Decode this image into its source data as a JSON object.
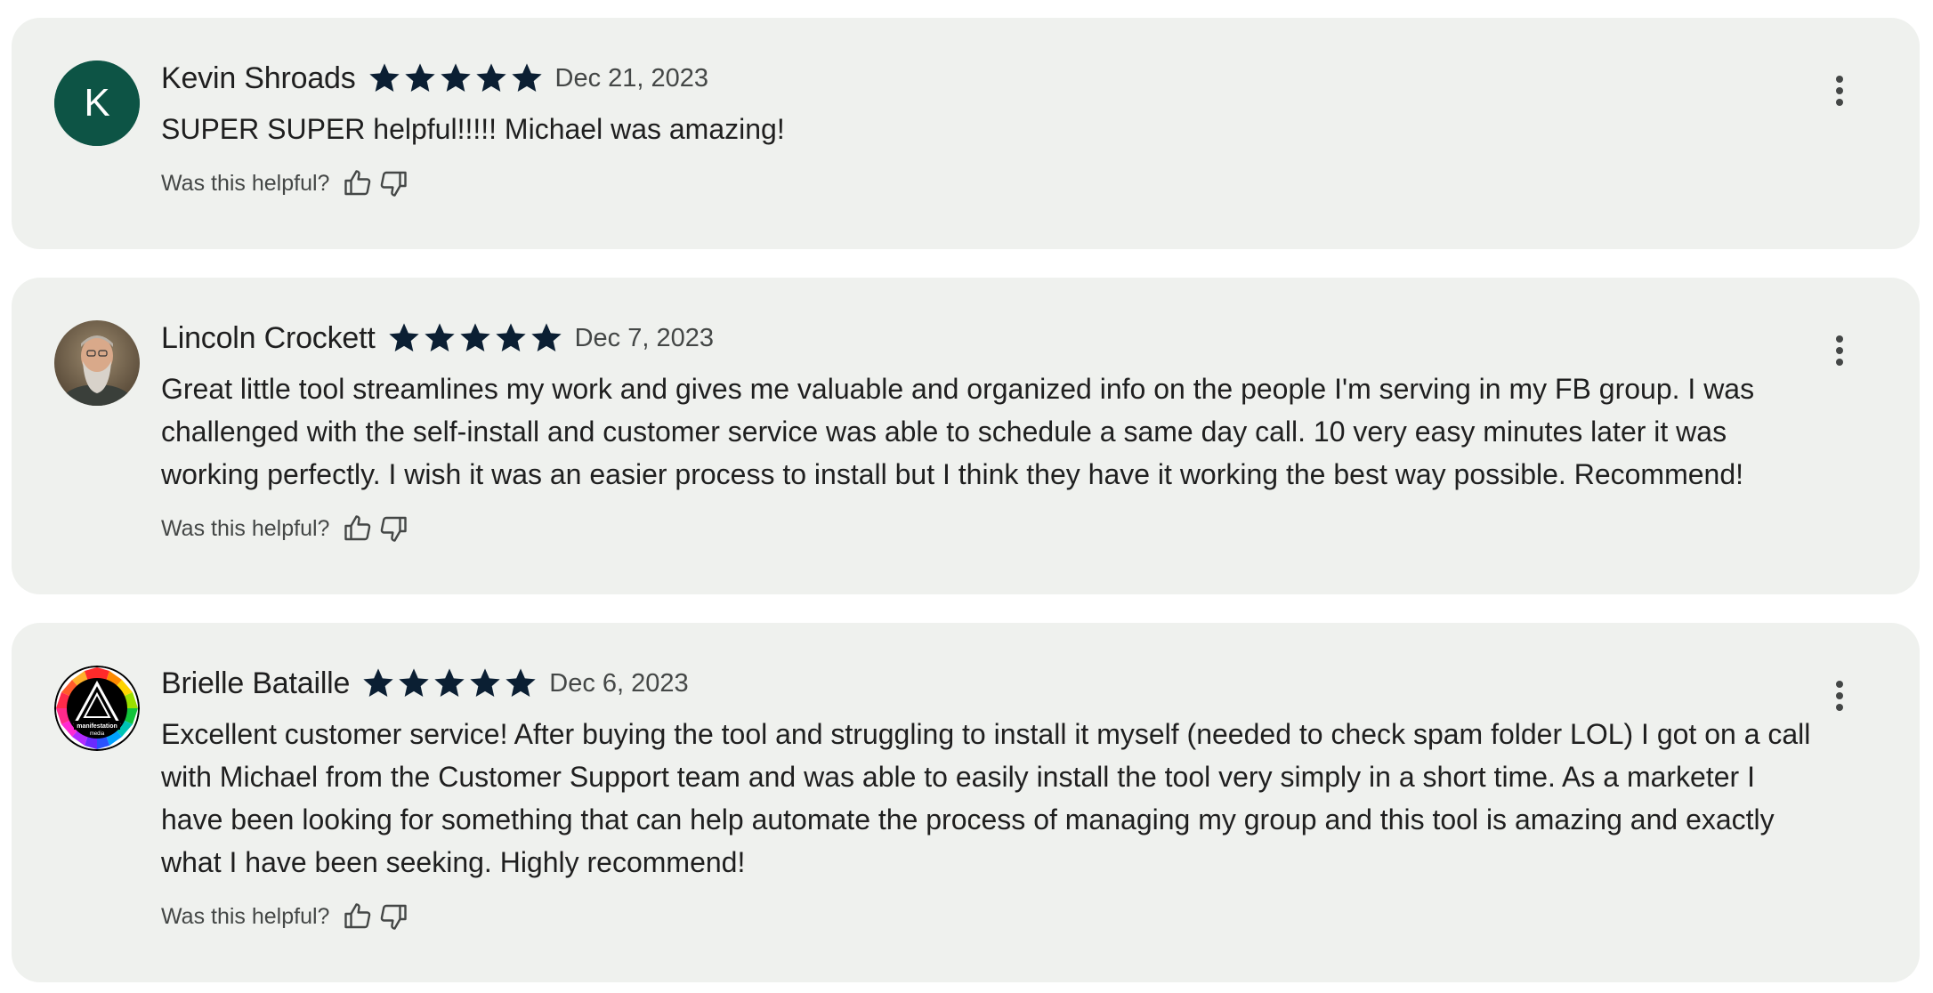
{
  "reviews": [
    {
      "name": "Kevin Shroads",
      "avatar_letter": "K",
      "avatar_color": "#0d5445",
      "rating": 5,
      "date": "Dec 21, 2023",
      "text": "SUPER SUPER helpful!!!!! Michael was amazing!",
      "helpful_label": "Was this helpful?"
    },
    {
      "name": "Lincoln Crockett",
      "avatar_letter": "",
      "avatar_color": "#7a6a55",
      "rating": 5,
      "date": "Dec 7, 2023",
      "text": "Great little tool streamlines my work and gives me valuable and organized info on the people I'm serving in my FB group. I was challenged with the self-install and customer service was able to schedule a same day call. 10 very easy minutes later it was working perfectly. I wish it was an easier process to install but I think they have it working the best way possible. Recommend!",
      "helpful_label": "Was this helpful?"
    },
    {
      "name": "Brielle Bataille",
      "avatar_letter": "",
      "avatar_color": "#000000",
      "avatar_logo_text": "manifestation media",
      "rating": 5,
      "date": "Dec 6, 2023",
      "text": "Excellent customer service! After buying the tool and struggling to install it myself (needed to check spam folder LOL) I got on a call with Michael from the Customer Support team and was able to easily install the tool very simply in a short time. As a marketer I have been looking for something that can help automate the process of managing my group and this tool is amazing and exactly what I have been seeking. Highly recommend!",
      "helpful_label": "Was this helpful?"
    }
  ],
  "colors": {
    "card_bg": "#eff1ee",
    "star": "#0b1f33",
    "text": "#1f1f1f",
    "secondary_text": "#444746"
  }
}
